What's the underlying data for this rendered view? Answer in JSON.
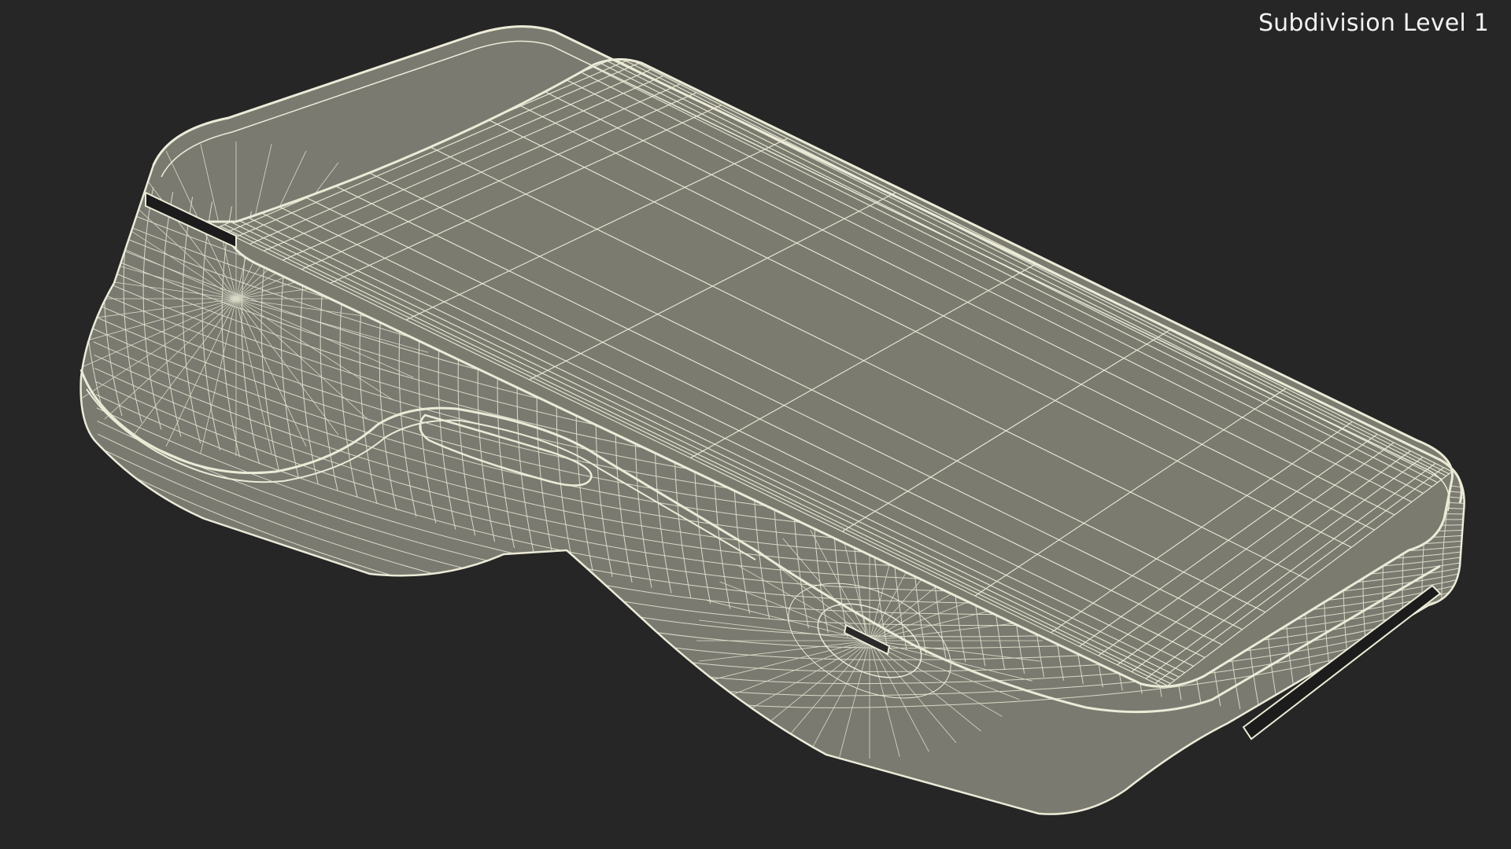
{
  "viewport": {
    "overlay_label": "Subdivision Level 1",
    "background_color": "#262626",
    "model_fill_color": "#7a7a70",
    "wire_color": "#ecebd8"
  },
  "model": {
    "name": "payment-terminal-wireframe"
  }
}
